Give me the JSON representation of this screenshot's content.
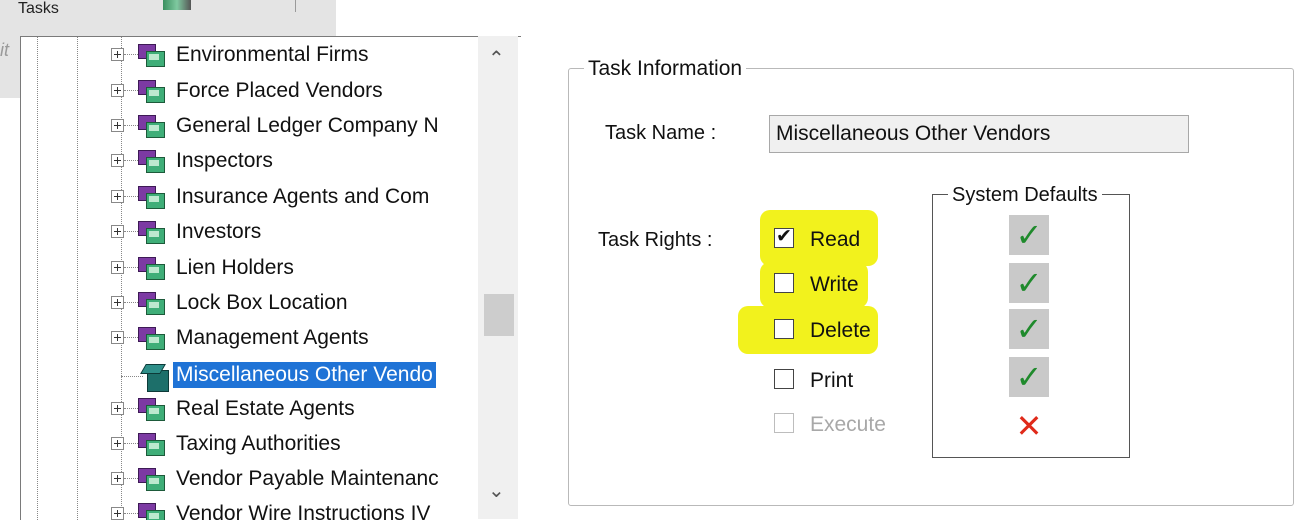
{
  "header": {
    "title": "Tasks",
    "side_fragment": "it"
  },
  "tree": {
    "items": [
      {
        "label": "Environmental Firms",
        "selected": false
      },
      {
        "label": "Force Placed Vendors",
        "selected": false
      },
      {
        "label": "General Ledger Company N",
        "selected": false
      },
      {
        "label": "Inspectors",
        "selected": false
      },
      {
        "label": "Insurance Agents and Com",
        "selected": false
      },
      {
        "label": "Investors",
        "selected": false
      },
      {
        "label": "Lien Holders",
        "selected": false
      },
      {
        "label": "Lock Box Location",
        "selected": false
      },
      {
        "label": "Management Agents",
        "selected": false
      },
      {
        "label": "Miscellaneous Other Vendo",
        "selected": true
      },
      {
        "label": "Real Estate Agents",
        "selected": false
      },
      {
        "label": "Taxing Authorities",
        "selected": false
      },
      {
        "label": "Vendor Payable Maintenanc",
        "selected": false
      },
      {
        "label": "Vendor Wire Instructions IV",
        "selected": false
      }
    ],
    "scroll_up_icon": "chevron-up-icon",
    "scroll_down_icon": "chevron-down-icon"
  },
  "task_info": {
    "legend": "Task Information",
    "task_name_label": "Task Name :",
    "task_name_value": "Miscellaneous Other Vendors",
    "task_rights_label": "Task Rights :",
    "rights": [
      {
        "label": "Read",
        "checked": true,
        "disabled": false,
        "highlighted": true
      },
      {
        "label": "Write",
        "checked": false,
        "disabled": false,
        "highlighted": true
      },
      {
        "label": "Delete",
        "checked": false,
        "disabled": false,
        "highlighted": true
      },
      {
        "label": "Print",
        "checked": false,
        "disabled": false,
        "highlighted": false
      },
      {
        "label": "Execute",
        "checked": false,
        "disabled": true,
        "highlighted": false
      }
    ],
    "system_defaults": {
      "legend": "System Defaults",
      "values": [
        "allowed",
        "allowed",
        "allowed",
        "allowed",
        "denied"
      ]
    }
  },
  "colors": {
    "selection": "#1f73d6",
    "highlight": "#f2f21d",
    "check_green": "#1f8a2c",
    "cross_red": "#e02a1a"
  }
}
